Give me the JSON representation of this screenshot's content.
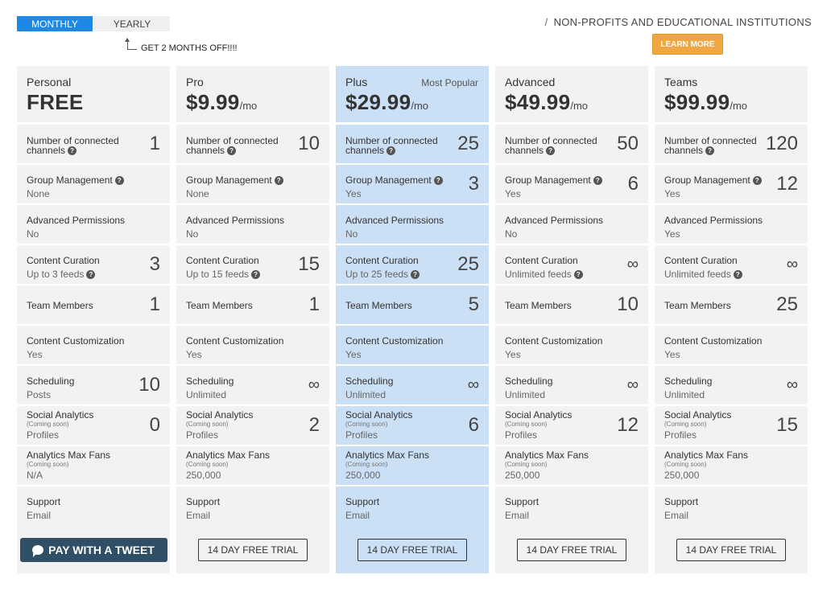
{
  "billing": {
    "monthly": "MONTHLY",
    "yearly": "YEARLY",
    "promo": "GET 2 MONTHS OFF!!!!"
  },
  "nonprofit": {
    "slash": "/",
    "text": "NON-PROFITS AND EDUCATIONAL INSTITUTIONS",
    "learn_more": "LEARN MORE"
  },
  "help_glyph": "?",
  "popular_label": "Most Popular",
  "colors": {
    "accent": "#1e88e5",
    "highlight": "#cbe0f5",
    "learn_more": "#f0a742",
    "tweet_button": "#2f4f66"
  },
  "plans": [
    {
      "name": "Personal",
      "price": "FREE",
      "per": "",
      "channels_label": "Number of connected channels",
      "channels": "1",
      "group_label": "Group Management",
      "group_sub": "None",
      "group_value": "",
      "perms_label": "Advanced Permissions",
      "perms_sub": "No",
      "curation_label": "Content Curation",
      "curation_sub": "Up to 3 feeds",
      "curation_value": "3",
      "team_label": "Team Members",
      "team_value": "1",
      "custom_label": "Content Customization",
      "custom_sub": "Yes",
      "sched_label": "Scheduling",
      "sched_sub": "Posts",
      "sched_value": "10",
      "analytics_label": "Social Analytics",
      "analytics_note": "(Coming soon)",
      "analytics_sub": "Profiles",
      "analytics_value": "0",
      "fans_label": "Analytics Max Fans",
      "fans_note": "(Coming soon)",
      "fans_sub": "N/A",
      "support_label": "Support",
      "support_sub": "Email",
      "cta": "PAY WITH A TWEET"
    },
    {
      "name": "Pro",
      "price": "$9.99",
      "per": "/mo",
      "channels_label": "Number of connected channels",
      "channels": "10",
      "group_label": "Group Management",
      "group_sub": "None",
      "group_value": "",
      "perms_label": "Advanced Permissions",
      "perms_sub": "No",
      "curation_label": "Content Curation",
      "curation_sub": "Up to 15 feeds",
      "curation_value": "15",
      "team_label": "Team Members",
      "team_value": "1",
      "custom_label": "Content Customization",
      "custom_sub": "Yes",
      "sched_label": "Scheduling",
      "sched_sub": "Unlimited",
      "sched_value": "∞",
      "analytics_label": "Social Analytics",
      "analytics_note": "(Coming soon)",
      "analytics_sub": "Profiles",
      "analytics_value": "2",
      "fans_label": "Analytics Max Fans",
      "fans_note": "(Coming soon)",
      "fans_sub": "250,000",
      "support_label": "Support",
      "support_sub": "Email",
      "cta": "14 DAY FREE TRIAL"
    },
    {
      "name": "Plus",
      "price": "$29.99",
      "per": "/mo",
      "channels_label": "Number of connected channels",
      "channels": "25",
      "group_label": "Group Management",
      "group_sub": "Yes",
      "group_value": "3",
      "perms_label": "Advanced Permissions",
      "perms_sub": "No",
      "curation_label": "Content Curation",
      "curation_sub": "Up to 25 feeds",
      "curation_value": "25",
      "team_label": "Team Members",
      "team_value": "5",
      "custom_label": "Content Customization",
      "custom_sub": "Yes",
      "sched_label": "Scheduling",
      "sched_sub": "Unlimited",
      "sched_value": "∞",
      "analytics_label": "Social Analytics",
      "analytics_note": "(Coming soon)",
      "analytics_sub": "Profiles",
      "analytics_value": "6",
      "fans_label": "Analytics Max Fans",
      "fans_note": "(Coming soon)",
      "fans_sub": "250,000",
      "support_label": "Support",
      "support_sub": "Email",
      "cta": "14 DAY FREE TRIAL"
    },
    {
      "name": "Advanced",
      "price": "$49.99",
      "per": "/mo",
      "channels_label": "Number of connected channels",
      "channels": "50",
      "group_label": "Group Management",
      "group_sub": "Yes",
      "group_value": "6",
      "perms_label": "Advanced Permissions",
      "perms_sub": "No",
      "curation_label": "Content Curation",
      "curation_sub": "Unlimited feeds",
      "curation_value": "∞",
      "team_label": "Team Members",
      "team_value": "10",
      "custom_label": "Content Customization",
      "custom_sub": "Yes",
      "sched_label": "Scheduling",
      "sched_sub": "Unlimited",
      "sched_value": "∞",
      "analytics_label": "Social Analytics",
      "analytics_note": "(Coming soon)",
      "analytics_sub": "Profiles",
      "analytics_value": "12",
      "fans_label": "Analytics Max Fans",
      "fans_note": "(Coming soon)",
      "fans_sub": "250,000",
      "support_label": "Support",
      "support_sub": "Email",
      "cta": "14 DAY FREE TRIAL"
    },
    {
      "name": "Teams",
      "price": "$99.99",
      "per": "/mo",
      "channels_label": "Number of connected channels",
      "channels": "120",
      "group_label": "Group Management",
      "group_sub": "Yes",
      "group_value": "12",
      "perms_label": "Advanced Permissions",
      "perms_sub": "Yes",
      "curation_label": "Content Curation",
      "curation_sub": "Unlimited feeds",
      "curation_value": "∞",
      "team_label": "Team Members",
      "team_value": "25",
      "custom_label": "Content Customization",
      "custom_sub": "Yes",
      "sched_label": "Scheduling",
      "sched_sub": "Unlimited",
      "sched_value": "∞",
      "analytics_label": "Social Analytics",
      "analytics_note": "(Coming soon)",
      "analytics_sub": "Profiles",
      "analytics_value": "15",
      "fans_label": "Analytics Max Fans",
      "fans_note": "(Coming soon)",
      "fans_sub": "250,000",
      "support_label": "Support",
      "support_sub": "Email",
      "cta": "14 DAY FREE TRIAL"
    }
  ]
}
